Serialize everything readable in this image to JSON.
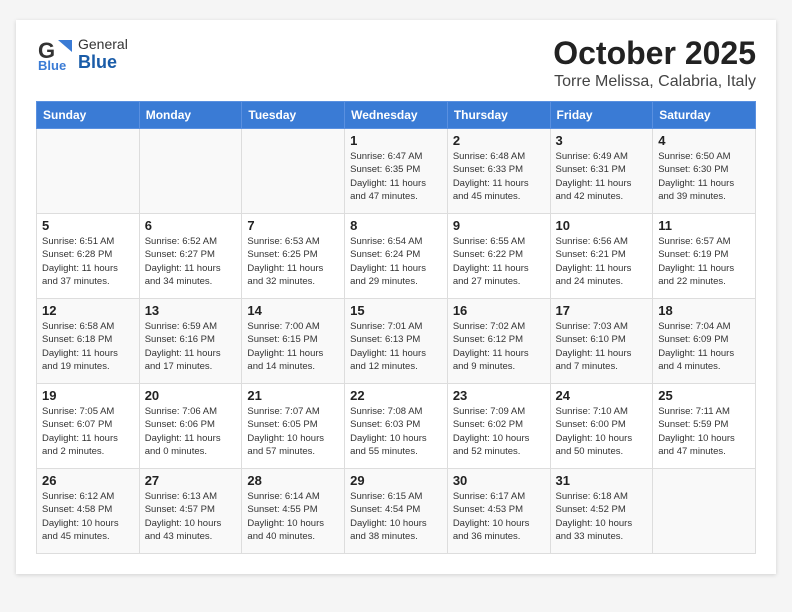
{
  "logo": {
    "general": "General",
    "blue": "Blue"
  },
  "title": "October 2025",
  "location": "Torre Melissa, Calabria, Italy",
  "days_of_week": [
    "Sunday",
    "Monday",
    "Tuesday",
    "Wednesday",
    "Thursday",
    "Friday",
    "Saturday"
  ],
  "weeks": [
    [
      {
        "day": "",
        "info": ""
      },
      {
        "day": "",
        "info": ""
      },
      {
        "day": "",
        "info": ""
      },
      {
        "day": "1",
        "info": "Sunrise: 6:47 AM\nSunset: 6:35 PM\nDaylight: 11 hours\nand 47 minutes."
      },
      {
        "day": "2",
        "info": "Sunrise: 6:48 AM\nSunset: 6:33 PM\nDaylight: 11 hours\nand 45 minutes."
      },
      {
        "day": "3",
        "info": "Sunrise: 6:49 AM\nSunset: 6:31 PM\nDaylight: 11 hours\nand 42 minutes."
      },
      {
        "day": "4",
        "info": "Sunrise: 6:50 AM\nSunset: 6:30 PM\nDaylight: 11 hours\nand 39 minutes."
      }
    ],
    [
      {
        "day": "5",
        "info": "Sunrise: 6:51 AM\nSunset: 6:28 PM\nDaylight: 11 hours\nand 37 minutes."
      },
      {
        "day": "6",
        "info": "Sunrise: 6:52 AM\nSunset: 6:27 PM\nDaylight: 11 hours\nand 34 minutes."
      },
      {
        "day": "7",
        "info": "Sunrise: 6:53 AM\nSunset: 6:25 PM\nDaylight: 11 hours\nand 32 minutes."
      },
      {
        "day": "8",
        "info": "Sunrise: 6:54 AM\nSunset: 6:24 PM\nDaylight: 11 hours\nand 29 minutes."
      },
      {
        "day": "9",
        "info": "Sunrise: 6:55 AM\nSunset: 6:22 PM\nDaylight: 11 hours\nand 27 minutes."
      },
      {
        "day": "10",
        "info": "Sunrise: 6:56 AM\nSunset: 6:21 PM\nDaylight: 11 hours\nand 24 minutes."
      },
      {
        "day": "11",
        "info": "Sunrise: 6:57 AM\nSunset: 6:19 PM\nDaylight: 11 hours\nand 22 minutes."
      }
    ],
    [
      {
        "day": "12",
        "info": "Sunrise: 6:58 AM\nSunset: 6:18 PM\nDaylight: 11 hours\nand 19 minutes."
      },
      {
        "day": "13",
        "info": "Sunrise: 6:59 AM\nSunset: 6:16 PM\nDaylight: 11 hours\nand 17 minutes."
      },
      {
        "day": "14",
        "info": "Sunrise: 7:00 AM\nSunset: 6:15 PM\nDaylight: 11 hours\nand 14 minutes."
      },
      {
        "day": "15",
        "info": "Sunrise: 7:01 AM\nSunset: 6:13 PM\nDaylight: 11 hours\nand 12 minutes."
      },
      {
        "day": "16",
        "info": "Sunrise: 7:02 AM\nSunset: 6:12 PM\nDaylight: 11 hours\nand 9 minutes."
      },
      {
        "day": "17",
        "info": "Sunrise: 7:03 AM\nSunset: 6:10 PM\nDaylight: 11 hours\nand 7 minutes."
      },
      {
        "day": "18",
        "info": "Sunrise: 7:04 AM\nSunset: 6:09 PM\nDaylight: 11 hours\nand 4 minutes."
      }
    ],
    [
      {
        "day": "19",
        "info": "Sunrise: 7:05 AM\nSunset: 6:07 PM\nDaylight: 11 hours\nand 2 minutes."
      },
      {
        "day": "20",
        "info": "Sunrise: 7:06 AM\nSunset: 6:06 PM\nDaylight: 11 hours\nand 0 minutes."
      },
      {
        "day": "21",
        "info": "Sunrise: 7:07 AM\nSunset: 6:05 PM\nDaylight: 10 hours\nand 57 minutes."
      },
      {
        "day": "22",
        "info": "Sunrise: 7:08 AM\nSunset: 6:03 PM\nDaylight: 10 hours\nand 55 minutes."
      },
      {
        "day": "23",
        "info": "Sunrise: 7:09 AM\nSunset: 6:02 PM\nDaylight: 10 hours\nand 52 minutes."
      },
      {
        "day": "24",
        "info": "Sunrise: 7:10 AM\nSunset: 6:00 PM\nDaylight: 10 hours\nand 50 minutes."
      },
      {
        "day": "25",
        "info": "Sunrise: 7:11 AM\nSunset: 5:59 PM\nDaylight: 10 hours\nand 47 minutes."
      }
    ],
    [
      {
        "day": "26",
        "info": "Sunrise: 6:12 AM\nSunset: 4:58 PM\nDaylight: 10 hours\nand 45 minutes."
      },
      {
        "day": "27",
        "info": "Sunrise: 6:13 AM\nSunset: 4:57 PM\nDaylight: 10 hours\nand 43 minutes."
      },
      {
        "day": "28",
        "info": "Sunrise: 6:14 AM\nSunset: 4:55 PM\nDaylight: 10 hours\nand 40 minutes."
      },
      {
        "day": "29",
        "info": "Sunrise: 6:15 AM\nSunset: 4:54 PM\nDaylight: 10 hours\nand 38 minutes."
      },
      {
        "day": "30",
        "info": "Sunrise: 6:17 AM\nSunset: 4:53 PM\nDaylight: 10 hours\nand 36 minutes."
      },
      {
        "day": "31",
        "info": "Sunrise: 6:18 AM\nSunset: 4:52 PM\nDaylight: 10 hours\nand 33 minutes."
      },
      {
        "day": "",
        "info": ""
      }
    ]
  ]
}
